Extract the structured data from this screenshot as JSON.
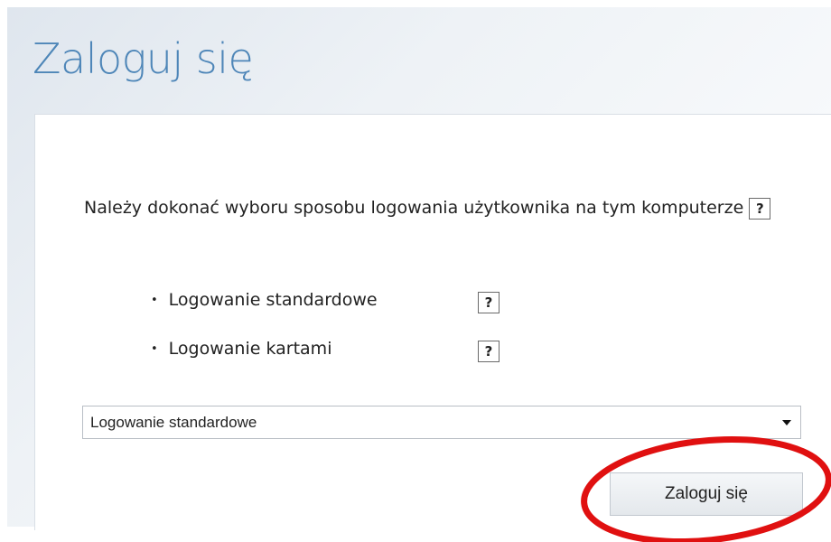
{
  "page": {
    "title": "Zaloguj się"
  },
  "info": {
    "text": "Należy dokonać wyboru sposobu logowania użytkownika na tym komputerze",
    "help": "?"
  },
  "options": [
    {
      "bullet": "•",
      "label": "Logowanie standardowe",
      "help": "?"
    },
    {
      "bullet": "•",
      "label": "Logowanie kartami",
      "help": "?"
    }
  ],
  "login_method_select": {
    "selected": "Logowanie standardowe"
  },
  "login_button": {
    "label": "Zaloguj się"
  },
  "annotation": {
    "color": "#e01010",
    "icon": "red-ellipse-highlight"
  }
}
